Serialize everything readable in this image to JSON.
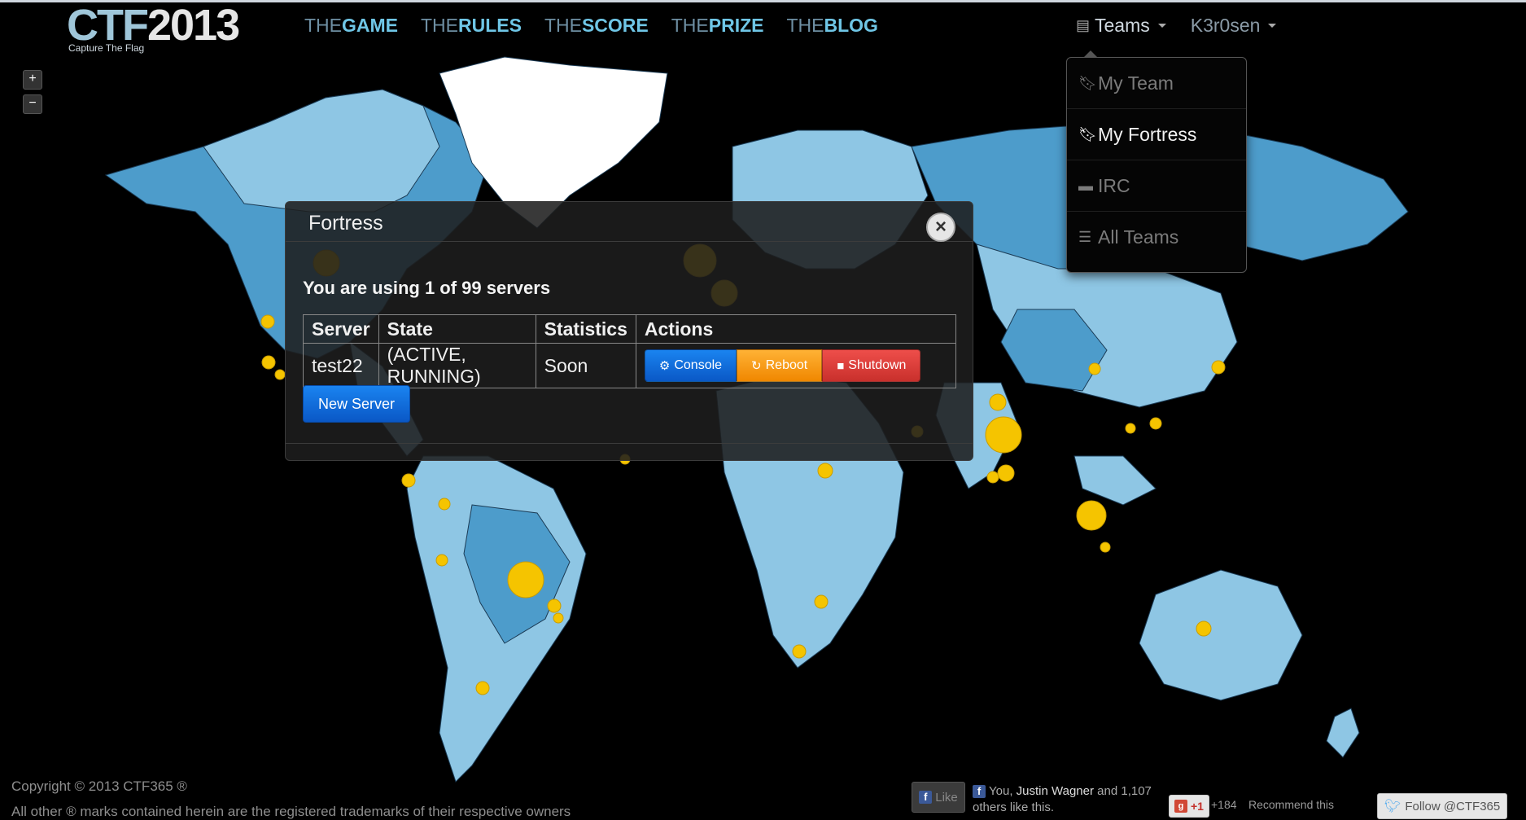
{
  "logo": {
    "main": "CTF",
    "year": "2013",
    "sub": "Capture The Flag"
  },
  "nav": [
    {
      "pre": "THE",
      "main": "GAME"
    },
    {
      "pre": "THE",
      "main": "RULES"
    },
    {
      "pre": "THE",
      "main": "SCORE"
    },
    {
      "pre": "THE",
      "main": "PRIZE"
    },
    {
      "pre": "THE",
      "main": "BLOG"
    }
  ],
  "header": {
    "teams_label": "Teams",
    "user_label": "K3r0sen"
  },
  "dropdown": {
    "items": [
      {
        "label": "My Team",
        "icon": "bookmark-icon"
      },
      {
        "label": "My Fortress",
        "icon": "bookmark-icon",
        "active": true
      },
      {
        "label": "IRC",
        "icon": "comment-icon"
      },
      {
        "label": "All Teams",
        "icon": "list-icon"
      }
    ]
  },
  "map": {
    "zoom_in": "+",
    "zoom_out": "−",
    "colors": {
      "ocean": "#000000",
      "land": "#8ec6e4",
      "land_dark": "#4d9ccb",
      "marker": "#f5c400",
      "marker_stroke": "#c99d00"
    }
  },
  "modal": {
    "title": "Fortress",
    "close_label": "×",
    "usage": "You are using 1 of 99 servers",
    "columns": [
      "Server",
      "State",
      "Statistics",
      "Actions"
    ],
    "rows": [
      {
        "server": "test22",
        "state": "(ACTIVE, RUNNING)",
        "statistics": "Soon"
      }
    ],
    "actions": {
      "console": "Console",
      "reboot": "Reboot",
      "shutdown": "Shutdown"
    },
    "new_server": "New Server"
  },
  "footer": {
    "copyright": "Copyright © 2013 CTF365 ®",
    "legal": "All other ® marks contained herein are the registered trademarks of their respective owners",
    "fb_like": "Like",
    "fb_text_you": "You, ",
    "fb_text_name": "Justin Wagner",
    "fb_text_rest": " and 1,107 others like this.",
    "gplus_label": "+1",
    "gplus_count": "+184",
    "recommend": "Recommend this",
    "twitter": "Follow @CTF365"
  }
}
